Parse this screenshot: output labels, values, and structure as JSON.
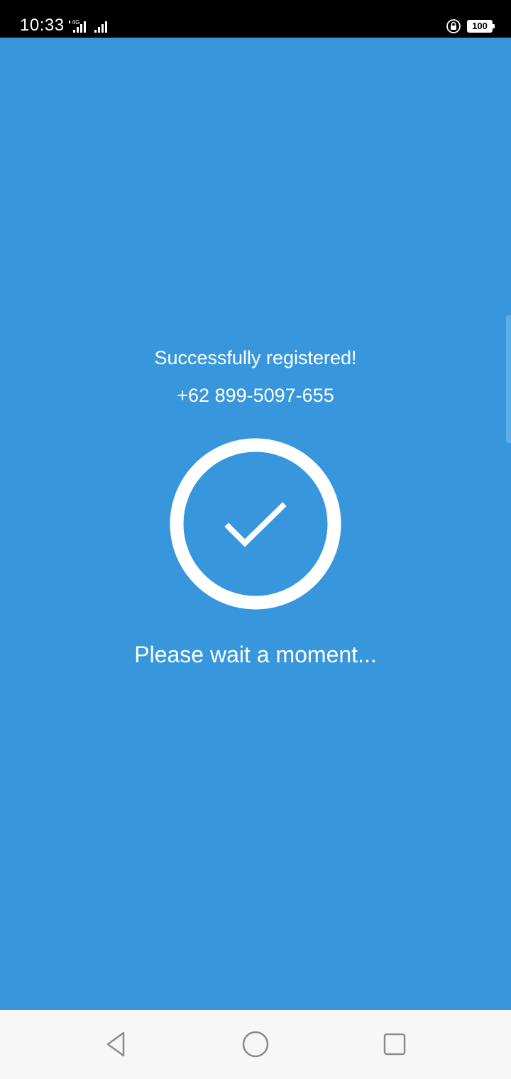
{
  "status_bar": {
    "time": "10:33",
    "network_label": "4G",
    "battery_level": "100",
    "icons": [
      "signal-4g-icon",
      "signal-bars-icon",
      "rotation-lock-icon",
      "battery-icon"
    ]
  },
  "main": {
    "title": "Successfully registered!",
    "phone_number": "+62 899-5097-655",
    "status_icon": "checkmark-circle-icon",
    "wait_message": "Please wait a moment..."
  },
  "nav_bar": {
    "buttons": [
      "back-icon",
      "home-icon",
      "recents-icon"
    ]
  },
  "colors": {
    "background": "#3897dc",
    "status_bar": "#000000",
    "nav_bar": "#f7f7f7",
    "foreground": "#ffffff"
  }
}
